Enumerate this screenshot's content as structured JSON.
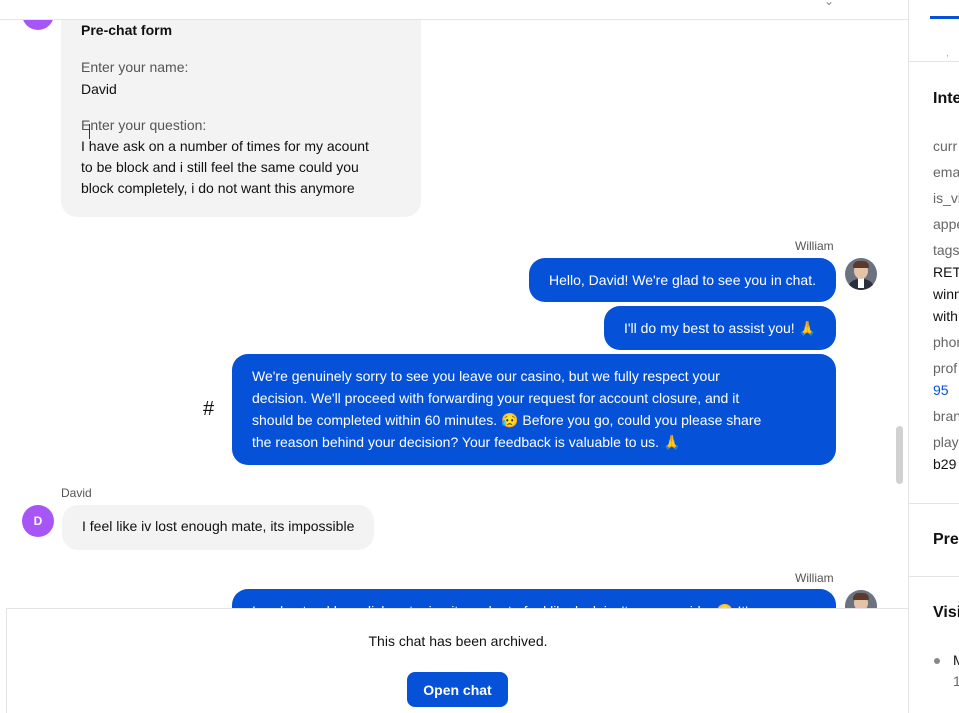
{
  "prechat": {
    "title": "Pre-chat form",
    "name_label": "Enter your name:",
    "name_value": "David",
    "question_label": "Enter your question:",
    "question_lines": [
      "I have ask on a number of times for my acount",
      "to be block and i still feel the same could you",
      "block completely, i do not want this anymore"
    ]
  },
  "messages": {
    "agent_name": "William",
    "agent_msg_1": "Hello, David! We're glad to see you in chat.",
    "agent_msg_2": "I'll do my best to assist you! 🙏",
    "agent_msg_3_lines": [
      "We're genuinely sorry to see you leave our casino, but we fully respect your",
      "decision. We'll proceed with forwarding your request for account closure, and it",
      "should be completed within 60 minutes. 😥 Before you go, could you please share",
      "the reason behind your decision? Your feedback is valuable to us. 🙏"
    ],
    "hash_symbol": "#",
    "customer_name": "David",
    "customer_initial": "D",
    "customer_msg_1": "I feel like iv lost enough mate, its impossible",
    "agent_name_2": "William",
    "agent_msg_4_partial": "I understand how disheartening it can be to feel like luck isn't on your side. 😔 It's"
  },
  "footer": {
    "archived_text": "This chat has been archived.",
    "open_chat_label": "Open chat"
  },
  "side_panel": {
    "section_1_title": "Inte",
    "attrs": {
      "a1": "curr",
      "a2": "ema",
      "a3": "is_vi",
      "a4": "appe",
      "a5": "tags",
      "tag_v1": "RET",
      "tag_v2": "winn",
      "tag_v3": "with",
      "a6": "phon",
      "a7": "prof",
      "link_v": "95",
      "a8": "bran",
      "a9": "play",
      "val_b": "b29"
    },
    "section_2_title": "Pre",
    "section_3_title": "Visi",
    "visit_item": "M",
    "visit_sub": "1"
  },
  "colors": {
    "accent": "#0552d8",
    "customer_avatar": "#a855f7",
    "bubble_in": "#f3f3f4"
  }
}
